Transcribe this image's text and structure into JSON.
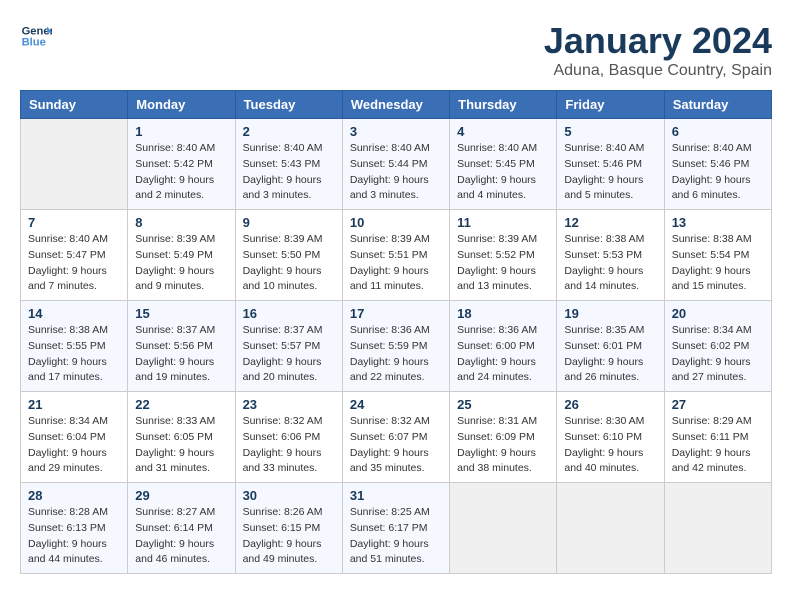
{
  "header": {
    "logo_line1": "General",
    "logo_line2": "Blue",
    "month": "January 2024",
    "location": "Aduna, Basque Country, Spain"
  },
  "weekdays": [
    "Sunday",
    "Monday",
    "Tuesday",
    "Wednesday",
    "Thursday",
    "Friday",
    "Saturday"
  ],
  "weeks": [
    [
      {
        "day": "",
        "info": ""
      },
      {
        "day": "1",
        "info": "Sunrise: 8:40 AM\nSunset: 5:42 PM\nDaylight: 9 hours\nand 2 minutes."
      },
      {
        "day": "2",
        "info": "Sunrise: 8:40 AM\nSunset: 5:43 PM\nDaylight: 9 hours\nand 3 minutes."
      },
      {
        "day": "3",
        "info": "Sunrise: 8:40 AM\nSunset: 5:44 PM\nDaylight: 9 hours\nand 3 minutes."
      },
      {
        "day": "4",
        "info": "Sunrise: 8:40 AM\nSunset: 5:45 PM\nDaylight: 9 hours\nand 4 minutes."
      },
      {
        "day": "5",
        "info": "Sunrise: 8:40 AM\nSunset: 5:46 PM\nDaylight: 9 hours\nand 5 minutes."
      },
      {
        "day": "6",
        "info": "Sunrise: 8:40 AM\nSunset: 5:46 PM\nDaylight: 9 hours\nand 6 minutes."
      }
    ],
    [
      {
        "day": "7",
        "info": "Sunrise: 8:40 AM\nSunset: 5:47 PM\nDaylight: 9 hours\nand 7 minutes."
      },
      {
        "day": "8",
        "info": "Sunrise: 8:39 AM\nSunset: 5:49 PM\nDaylight: 9 hours\nand 9 minutes."
      },
      {
        "day": "9",
        "info": "Sunrise: 8:39 AM\nSunset: 5:50 PM\nDaylight: 9 hours\nand 10 minutes."
      },
      {
        "day": "10",
        "info": "Sunrise: 8:39 AM\nSunset: 5:51 PM\nDaylight: 9 hours\nand 11 minutes."
      },
      {
        "day": "11",
        "info": "Sunrise: 8:39 AM\nSunset: 5:52 PM\nDaylight: 9 hours\nand 13 minutes."
      },
      {
        "day": "12",
        "info": "Sunrise: 8:38 AM\nSunset: 5:53 PM\nDaylight: 9 hours\nand 14 minutes."
      },
      {
        "day": "13",
        "info": "Sunrise: 8:38 AM\nSunset: 5:54 PM\nDaylight: 9 hours\nand 15 minutes."
      }
    ],
    [
      {
        "day": "14",
        "info": "Sunrise: 8:38 AM\nSunset: 5:55 PM\nDaylight: 9 hours\nand 17 minutes."
      },
      {
        "day": "15",
        "info": "Sunrise: 8:37 AM\nSunset: 5:56 PM\nDaylight: 9 hours\nand 19 minutes."
      },
      {
        "day": "16",
        "info": "Sunrise: 8:37 AM\nSunset: 5:57 PM\nDaylight: 9 hours\nand 20 minutes."
      },
      {
        "day": "17",
        "info": "Sunrise: 8:36 AM\nSunset: 5:59 PM\nDaylight: 9 hours\nand 22 minutes."
      },
      {
        "day": "18",
        "info": "Sunrise: 8:36 AM\nSunset: 6:00 PM\nDaylight: 9 hours\nand 24 minutes."
      },
      {
        "day": "19",
        "info": "Sunrise: 8:35 AM\nSunset: 6:01 PM\nDaylight: 9 hours\nand 26 minutes."
      },
      {
        "day": "20",
        "info": "Sunrise: 8:34 AM\nSunset: 6:02 PM\nDaylight: 9 hours\nand 27 minutes."
      }
    ],
    [
      {
        "day": "21",
        "info": "Sunrise: 8:34 AM\nSunset: 6:04 PM\nDaylight: 9 hours\nand 29 minutes."
      },
      {
        "day": "22",
        "info": "Sunrise: 8:33 AM\nSunset: 6:05 PM\nDaylight: 9 hours\nand 31 minutes."
      },
      {
        "day": "23",
        "info": "Sunrise: 8:32 AM\nSunset: 6:06 PM\nDaylight: 9 hours\nand 33 minutes."
      },
      {
        "day": "24",
        "info": "Sunrise: 8:32 AM\nSunset: 6:07 PM\nDaylight: 9 hours\nand 35 minutes."
      },
      {
        "day": "25",
        "info": "Sunrise: 8:31 AM\nSunset: 6:09 PM\nDaylight: 9 hours\nand 38 minutes."
      },
      {
        "day": "26",
        "info": "Sunrise: 8:30 AM\nSunset: 6:10 PM\nDaylight: 9 hours\nand 40 minutes."
      },
      {
        "day": "27",
        "info": "Sunrise: 8:29 AM\nSunset: 6:11 PM\nDaylight: 9 hours\nand 42 minutes."
      }
    ],
    [
      {
        "day": "28",
        "info": "Sunrise: 8:28 AM\nSunset: 6:13 PM\nDaylight: 9 hours\nand 44 minutes."
      },
      {
        "day": "29",
        "info": "Sunrise: 8:27 AM\nSunset: 6:14 PM\nDaylight: 9 hours\nand 46 minutes."
      },
      {
        "day": "30",
        "info": "Sunrise: 8:26 AM\nSunset: 6:15 PM\nDaylight: 9 hours\nand 49 minutes."
      },
      {
        "day": "31",
        "info": "Sunrise: 8:25 AM\nSunset: 6:17 PM\nDaylight: 9 hours\nand 51 minutes."
      },
      {
        "day": "",
        "info": ""
      },
      {
        "day": "",
        "info": ""
      },
      {
        "day": "",
        "info": ""
      }
    ]
  ]
}
